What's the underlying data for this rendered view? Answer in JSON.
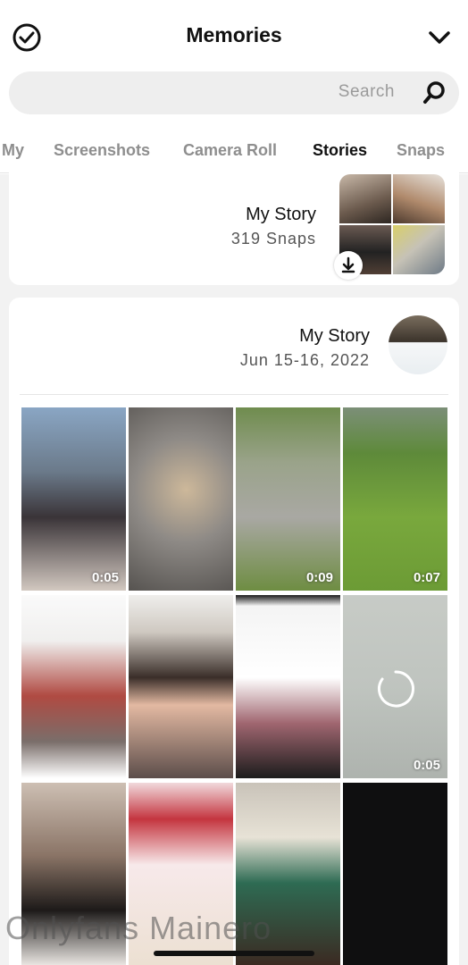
{
  "header": {
    "title": "Memories",
    "left_icon": "clock-check-icon",
    "right_icon": "chevron-down-icon"
  },
  "search": {
    "placeholder": "Search",
    "icon": "search-icon"
  },
  "tabs": [
    {
      "label": "My",
      "active": false
    },
    {
      "label": "Screenshots",
      "active": false
    },
    {
      "label": "Camera Roll",
      "active": false
    },
    {
      "label": "Stories",
      "active": true
    },
    {
      "label": "Snaps",
      "active": false
    }
  ],
  "story_summary": {
    "name": "My Story",
    "count": "319 Snaps",
    "download_icon": "download-icon"
  },
  "story_group": {
    "name": "My Story",
    "date": "Jun 15-16, 2022"
  },
  "grid": {
    "rows": [
      [
        {
          "duration": "0:05"
        },
        {
          "duration": ""
        },
        {
          "duration": "0:09"
        },
        {
          "duration": "0:07"
        }
      ],
      [
        {
          "duration": ""
        },
        {
          "duration": ""
        },
        {
          "duration": ""
        },
        {
          "duration": "0:05"
        }
      ],
      [
        {
          "duration": ""
        },
        {
          "duration": ""
        },
        {
          "duration": ""
        },
        {
          "duration": ""
        }
      ]
    ]
  },
  "watermark": "Onlyfans Mainero",
  "colors": {
    "accent": "#111111",
    "tab_inactive": "#8e8e8e",
    "background": "#f2f2f2"
  }
}
